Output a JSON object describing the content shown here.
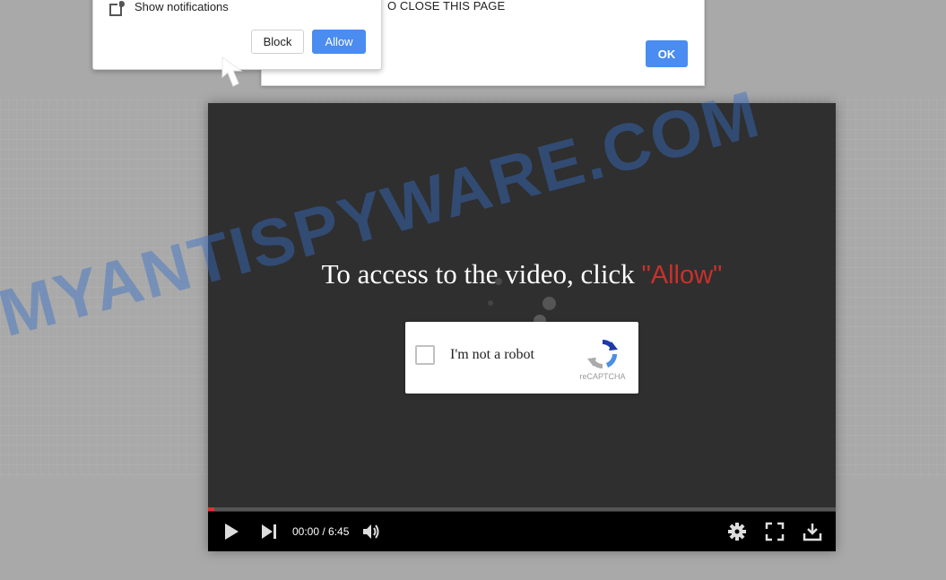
{
  "alert": {
    "message": "O CLOSE THIS PAGE",
    "ok_label": "OK"
  },
  "notification_prompt": {
    "icon": "notification-bell-icon",
    "text": "Show notifications",
    "block_label": "Block",
    "allow_label": "Allow"
  },
  "player": {
    "title_prefix": "To access to the video, click ",
    "title_highlight": "\"Allow\"",
    "captcha": {
      "label": "I'm not a robot",
      "brand": "reCAPTCHA",
      "checked": false
    },
    "time": "00:00 / 6:45",
    "progress": 0.01,
    "controls": [
      "play-icon",
      "next-icon",
      "volume-icon",
      "settings-icon",
      "fullscreen-icon",
      "download-icon"
    ]
  },
  "watermark": "MYANTISPYWARE.COM",
  "colors": {
    "accent": "#4a8cf0",
    "highlight": "#c9302c",
    "player_bg": "#2f2f2f",
    "watermark": "#376ec8"
  }
}
